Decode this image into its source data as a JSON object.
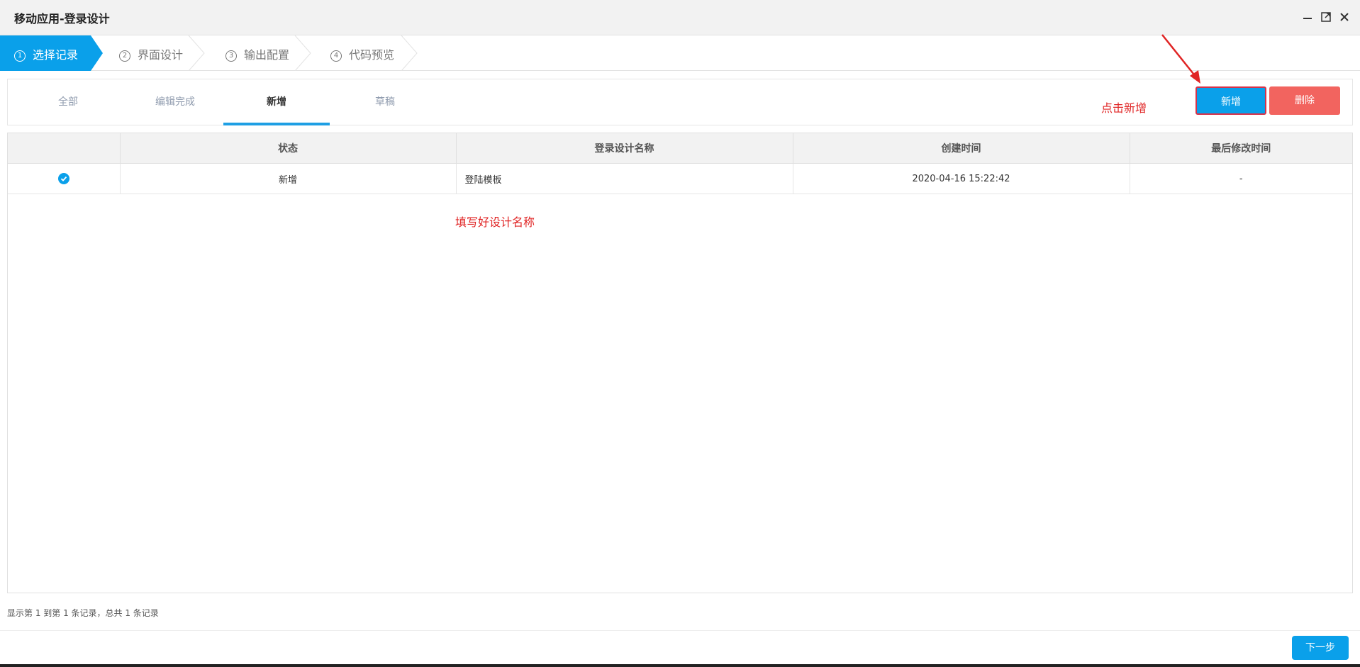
{
  "window": {
    "title": "移动应用-登录设计"
  },
  "steps": [
    {
      "num": "1",
      "label": "选择记录",
      "active": true
    },
    {
      "num": "2",
      "label": "界面设计",
      "active": false
    },
    {
      "num": "3",
      "label": "输出配置",
      "active": false
    },
    {
      "num": "4",
      "label": "代码预览",
      "active": false
    }
  ],
  "tabs": [
    {
      "label": "全部",
      "active": false
    },
    {
      "label": "编辑完成",
      "active": false
    },
    {
      "label": "新增",
      "active": true
    },
    {
      "label": "草稿",
      "active": false
    }
  ],
  "toolbar": {
    "add_label": "新增",
    "delete_label": "删除"
  },
  "annotations": {
    "click_add": "点击新增",
    "fill_name": "填写好设计名称"
  },
  "table": {
    "headers": [
      "",
      "状态",
      "登录设计名称",
      "创建时间",
      "最后修改时间"
    ],
    "rows": [
      {
        "checked": true,
        "status": "新增",
        "name": "登陆模板",
        "created": "2020-04-16 15:22:42",
        "modified": "-"
      }
    ]
  },
  "footer": {
    "record_info": "显示第 1 到第 1 条记录，总共 1 条记录",
    "next_label": "下一步"
  },
  "colors": {
    "accent": "#0aa0ea",
    "danger": "#f2645f",
    "annotation": "#e02424",
    "status_new": "#a5d86e"
  }
}
